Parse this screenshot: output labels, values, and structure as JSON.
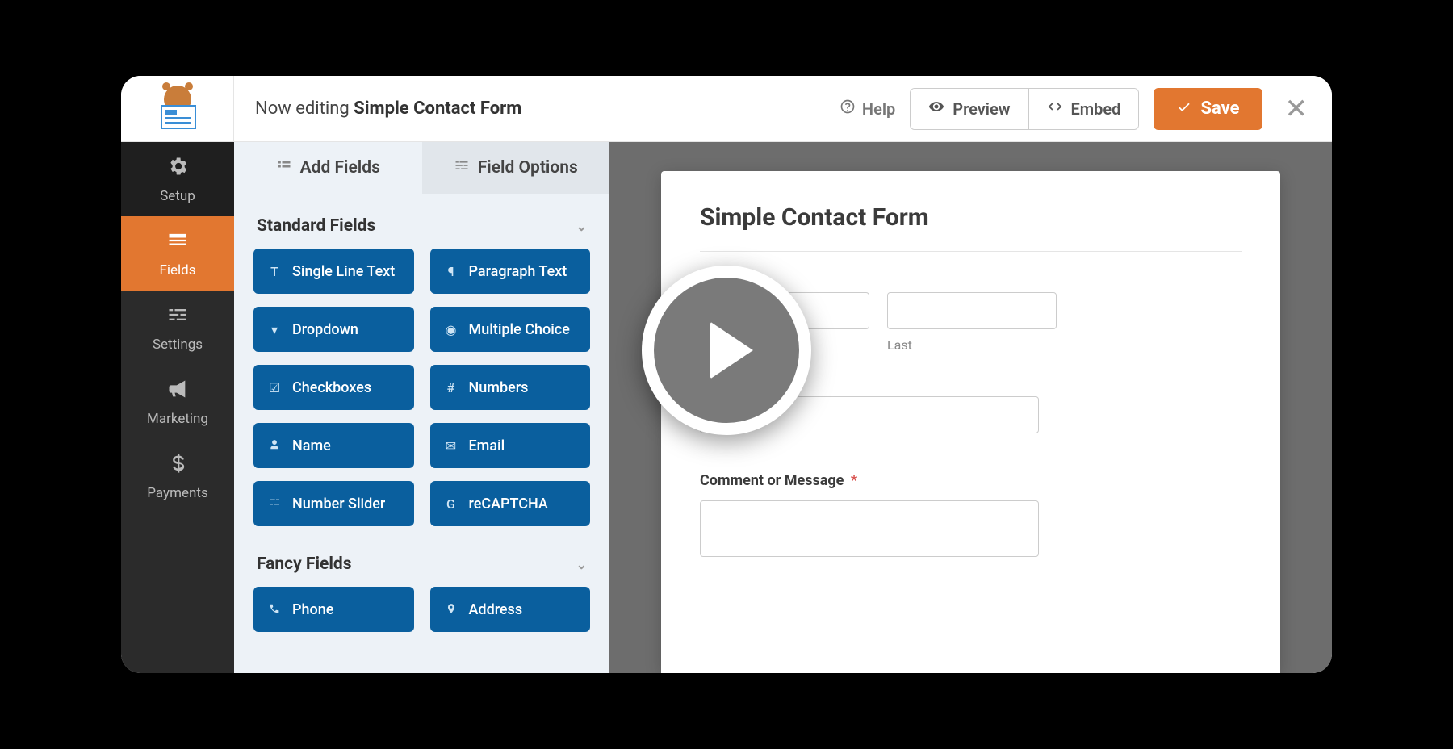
{
  "header": {
    "editing_prefix": "Now editing",
    "form_name": "Simple Contact Form",
    "help": "Help",
    "preview": "Preview",
    "embed": "Embed",
    "save": "Save"
  },
  "sidebar": {
    "setup": "Setup",
    "fields": "Fields",
    "settings": "Settings",
    "marketing": "Marketing",
    "payments": "Payments"
  },
  "tabs": {
    "add_fields": "Add Fields",
    "field_options": "Field Options"
  },
  "sections": {
    "standard": "Standard Fields",
    "fancy": "Fancy Fields"
  },
  "fields": {
    "single_line_text": "Single Line Text",
    "paragraph_text": "Paragraph Text",
    "dropdown": "Dropdown",
    "multiple_choice": "Multiple Choice",
    "checkboxes": "Checkboxes",
    "numbers": "Numbers",
    "name": "Name",
    "email": "Email",
    "number_slider": "Number Slider",
    "recaptcha": "reCAPTCHA",
    "phone": "Phone",
    "address": "Address"
  },
  "preview": {
    "title": "Simple Contact Form",
    "last": "Last",
    "comment_label": "Comment or Message",
    "required_mark": "*"
  }
}
